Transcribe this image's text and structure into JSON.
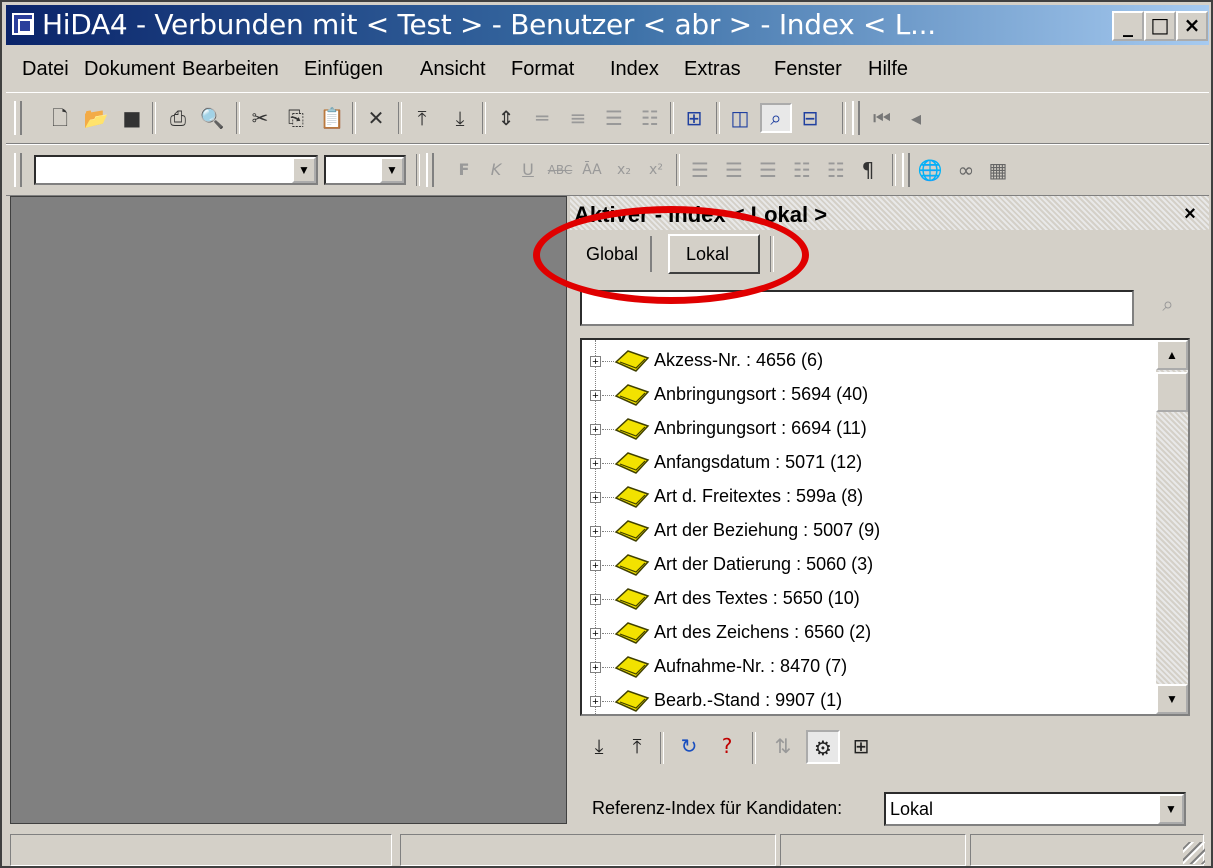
{
  "window": {
    "title": "HiDA4 - Verbunden mit < Test > - Benutzer < abr > - Index < L..."
  },
  "menu": [
    "Datei",
    "Dokument",
    "Bearbeiten",
    "Einfügen",
    "Ansicht",
    "Format",
    "Index",
    "Extras",
    "Fenster",
    "Hilfe"
  ],
  "panel": {
    "title": "Aktiver  - Index < Lokal >",
    "tabs": {
      "global": "Global",
      "lokal": "Lokal"
    },
    "search_value": ""
  },
  "tree": {
    "items": [
      "Akzess-Nr. : 4656 (6)",
      "Anbringungsort : 5694 (40)",
      "Anbringungsort : 6694 (11)",
      "Anfangsdatum : 5071 (12)",
      "Art d. Freitextes : 599a (8)",
      "Art der Beziehung : 5007 (9)",
      "Art der Datierung : 5060 (3)",
      "Art des Textes : 5650 (10)",
      "Art des Zeichens : 6560 (2)",
      "Aufnahme-Nr. : 8470 (7)",
      "Bearb.-Stand : 9907 (1)"
    ]
  },
  "reference": {
    "label": "Referenz-Index für Kandidaten:",
    "value": "Lokal"
  },
  "colors": {
    "titlebar": "#0a246a",
    "highlight_circle": "#e00000",
    "book": "#f2e200"
  }
}
